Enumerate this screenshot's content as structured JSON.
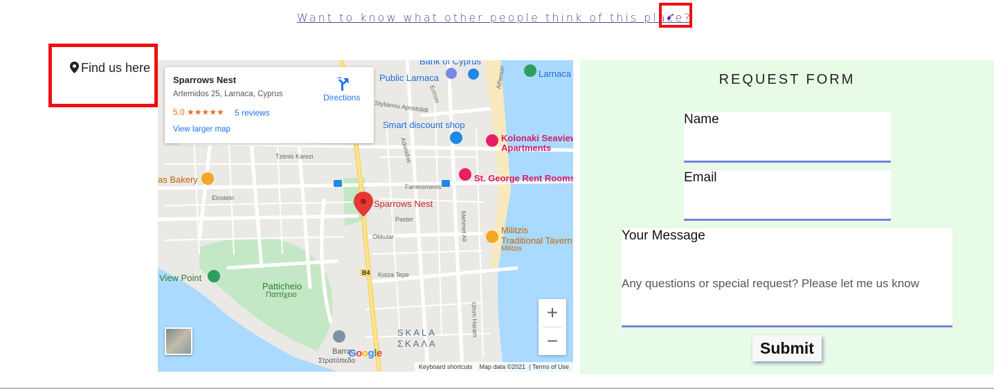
{
  "top": {
    "link_text": "Want to know what other people think of this place?"
  },
  "find": {
    "label": "Find us here"
  },
  "map": {
    "place_name": "Sparrows Nest",
    "address": "Artemidos 25, Larnaca, Cyprus",
    "rating": "5.0 ★★★★★",
    "reviews": "5 reviews",
    "larger_map": "View larger map",
    "directions": "Directions",
    "pin_label": "Sparrows Nest",
    "labels": {
      "bank": "Bank of Cyprus",
      "public_larnaca": "Public Larnaca",
      "larnaca": "Larnaca",
      "smart": "Smart discount shop",
      "kolonaki_1": "Kolonaki Seaview",
      "kolonaki_2": "Apartments",
      "bakery": "as Bakery",
      "st_george": "St. George Rent Rooms",
      "militzis_1": "Militzis",
      "militzis_2": "Traditional Tavern",
      "militzis_3": "Militzis",
      "view_point": "View Point",
      "pattich_1": "Patticheio",
      "pattich_2": "Παττίχειο",
      "skala_1": "SKALA",
      "skala_2": "ΣΚΑΛΑ",
      "barrac_1": "Barrac",
      "barrac_2": "Στρατόπεδο",
      "google": "Google",
      "okkular": "Okkular",
      "faneromenis": "Faneromenis",
      "kotza": "Kotza Tepe",
      "ermou": "Ermou",
      "adonidos": "Adonidos",
      "mehmet": "Mehmet Ali",
      "pastor": "Paster",
      "einstein": "Einstein",
      "athenon": "Athenon",
      "stylianou": "Stylianou Apostolidi",
      "tzenis": "Tzenis Karezi",
      "b4": "B4",
      "umm": "Umm Haram"
    },
    "zoom_in": "+",
    "zoom_out": "−",
    "keyboard": "Keyboard shortcuts",
    "mapdata": "Map data ©2021",
    "terms": "Terms of Use"
  },
  "form": {
    "title": "REQUEST FORM",
    "name_label": "Name",
    "email_label": "Email",
    "message_label": "Your Message",
    "message_placeholder": "Any questions or special request? Please let me us know",
    "submit": "Submit"
  },
  "colors": {
    "highlight": "#ee1010",
    "form_bg": "#e7fbe7",
    "field_underline": "#7581e3",
    "link": "#5b3f8a"
  }
}
